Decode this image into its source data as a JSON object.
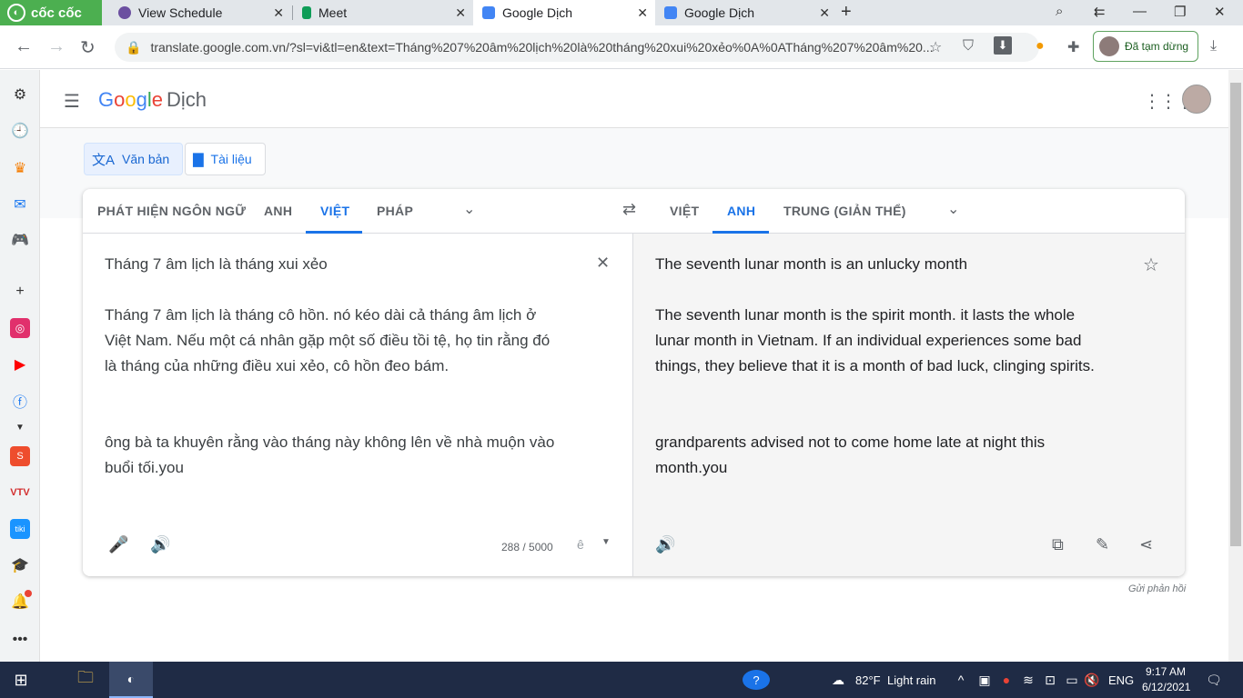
{
  "browser": {
    "brand": "cốc cốc",
    "tabs": [
      {
        "title": "View Schedule",
        "active": false
      },
      {
        "title": "Meet",
        "active": false
      },
      {
        "title": "Google Dịch",
        "active": true
      },
      {
        "title": "Google Dịch",
        "active": false
      }
    ],
    "url": "translate.google.com.vn/?sl=vi&tl=en&text=Tháng%207%20âm%20lịch%20là%20tháng%20xui%20xẻo%0A%0ATháng%207%20âm%20...",
    "profile_status": "Đã tạm dừng",
    "notification_color": "#ea4335"
  },
  "app": {
    "title_google": [
      "G",
      "o",
      "o",
      "g",
      "l",
      "e"
    ],
    "title_suffix": "Dịch"
  },
  "modes": [
    {
      "label": "Văn bản",
      "active": true
    },
    {
      "label": "Tài liệu",
      "active": false
    }
  ],
  "source_langs": [
    "PHÁT HIỆN NGÔN NGỮ",
    "ANH",
    "VIỆT",
    "PHÁP"
  ],
  "source_active": "VIỆT",
  "target_langs": [
    "VIỆT",
    "ANH",
    "TRUNG (GIẢN THỂ)"
  ],
  "target_active": "ANH",
  "source": {
    "line1": "Tháng 7 âm lịch là tháng xui xẻo",
    "para2": [
      "Tháng 7 âm lịch là tháng cô hồn. nó kéo dài cả tháng âm lịch ở",
      "Việt Nam. Nếu một cá nhân gặp một số điều tồi tệ, họ tin rằng đó",
      "là tháng của những điều xui xẻo, cô hồn đeo bám."
    ],
    "para3": [
      "ông bà ta khuyên rằng vào tháng này không lên về nhà muộn vào",
      "buổi tối.you"
    ],
    "char_count": "288 / 5000"
  },
  "target": {
    "line1": "The seventh lunar month is an unlucky month",
    "para2": [
      "The seventh lunar month is the spirit month. it lasts the whole",
      "lunar month in Vietnam. If an individual experiences some bad",
      "things, they believe that it is a month of bad luck, clinging spirits."
    ],
    "para3": [
      "grandparents advised not to come home late at night this",
      "month.you"
    ]
  },
  "feedback": "Gửi phản hồi",
  "taskbar": {
    "weather_temp": "82°F",
    "weather_desc": "Light rain",
    "lang": "ENG",
    "time": "9:17 AM",
    "date": "6/12/2021"
  }
}
